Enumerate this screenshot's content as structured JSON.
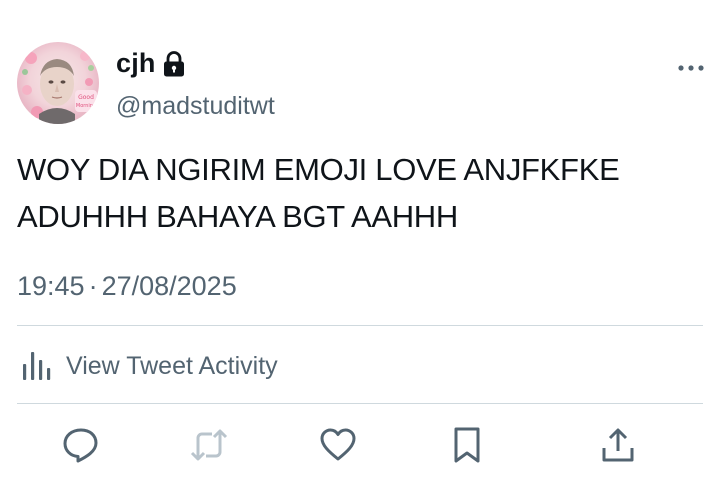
{
  "tweet": {
    "display_name": "cjh",
    "handle": "@madstuditwt",
    "text": "WOY DIA NGIRIM EMOJI LOVE ANJFKFKE ADUHHH BAHAYA BGT AAHHH",
    "time": "19:45",
    "separator": "·",
    "date": "27/08/2025"
  },
  "avatar": {
    "sticker_line1": "Good",
    "sticker_line2": "Morning"
  },
  "activity": {
    "label": "View Tweet Activity"
  },
  "icons": {
    "lock": "lock-icon",
    "more": "more-icon",
    "activity": "bar-chart-icon",
    "reply": "reply-icon",
    "retweet": "retweet-icon",
    "like": "heart-icon",
    "bookmark": "bookmark-icon",
    "share": "share-icon"
  },
  "colors": {
    "text_primary": "#0f1419",
    "text_secondary": "#536471",
    "divider": "#cfd9de"
  }
}
